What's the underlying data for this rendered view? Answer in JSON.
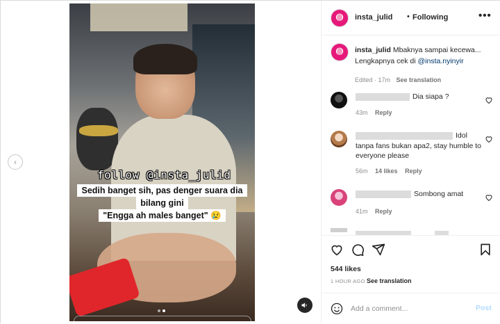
{
  "post": {
    "username": "insta_julid",
    "follow_status": "Following",
    "separator": "•",
    "more": "•••",
    "video_overlay_handle": "follow @insta_julid",
    "video_caption_lines": [
      "Sedih banget sih, pas denger suara dia",
      "bilang gini",
      "\"Engga ah males banget\" 😢"
    ]
  },
  "caption": {
    "username": "insta_julid",
    "text": "Mbaknya sampai kecewa...",
    "line2_prefix": "Lengkapnya cek di ",
    "link": "@insta.nyinyir",
    "meta": "Edited · 17m",
    "see_translation": "See translation"
  },
  "comments": [
    {
      "text": "Dia siapa ?",
      "time": "43m",
      "reply": "Reply",
      "likes": ""
    },
    {
      "text": "Idol tanpa fans bukan apa2, stay humble to everyone please",
      "time": "56m",
      "reply": "Reply",
      "likes": "14 likes"
    },
    {
      "text": "Sombong amat",
      "time": "41m",
      "reply": "Reply",
      "likes": ""
    }
  ],
  "actions": {
    "likes": "544 likes",
    "time": "1 HOUR AGO",
    "see_translation": "See translation"
  },
  "add_comment": {
    "placeholder": "Add a comment...",
    "post_label": "Post"
  },
  "colors": {
    "accent_link": "#00376b",
    "post_disabled": "#b3dbff",
    "avatar_pink": "#e6197a"
  }
}
